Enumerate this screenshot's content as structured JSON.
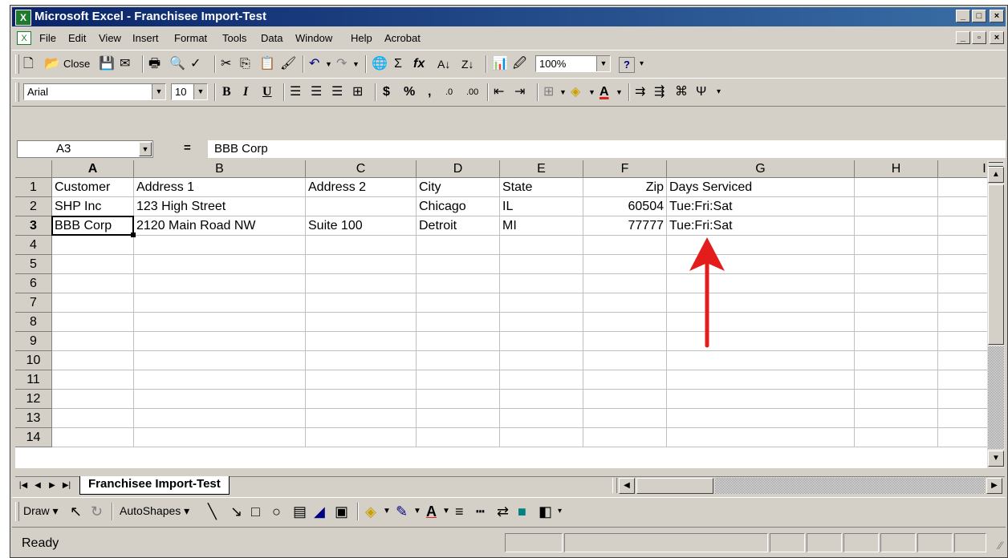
{
  "window": {
    "title": "Microsoft Excel - Franchisee Import-Test",
    "app_icon": "excel-icon"
  },
  "caption_buttons": {
    "minimize": "_",
    "restore": "□",
    "close": "×"
  },
  "menu": {
    "items": [
      "File",
      "Edit",
      "View",
      "Insert",
      "Format",
      "Tools",
      "Data",
      "Window",
      "Help",
      "Acrobat"
    ],
    "doc_buttons": {
      "minimize": "_",
      "restore": "▫",
      "close": "×"
    }
  },
  "standard_toolbar": {
    "close_label": "Close",
    "undo_glyph": "↶",
    "redo_glyph": "↷",
    "sum_glyph": "Σ",
    "function_glyph": "fx",
    "zoom": "100%",
    "help_glyph": "?"
  },
  "format_toolbar": {
    "font": "Arial",
    "size": "10",
    "bold": "B",
    "italic": "I",
    "underline": "U",
    "currency": "$",
    "percent": "%",
    "comma": ",",
    "increase_decimal": ".0",
    "decrease_decimal": ".00",
    "font_color_glyph": "A"
  },
  "formula_bar": {
    "name_box": "A3",
    "equals": "=",
    "value": "BBB Corp"
  },
  "sheet": {
    "columns": [
      "A",
      "B",
      "C",
      "D",
      "E",
      "F",
      "G",
      "H",
      "I"
    ],
    "rows": [
      "1",
      "2",
      "3",
      "4",
      "5",
      "6",
      "7",
      "8",
      "9",
      "10",
      "11",
      "12",
      "13",
      "14"
    ],
    "active_cell": "A3",
    "data": [
      [
        "Customer",
        "Address 1",
        "Address 2",
        "City",
        "State",
        "Zip",
        "Days Serviced"
      ],
      [
        "SHP Inc",
        "123 High Street",
        "",
        "Chicago",
        "IL",
        "60504",
        "Tue:Fri:Sat"
      ],
      [
        "BBB Corp",
        "2120 Main Road NW",
        "Suite 100",
        "Detroit",
        "MI",
        "77777",
        "Tue:Fri:Sat"
      ]
    ],
    "annotation": {
      "type": "red-arrow",
      "color": "#e31c1c",
      "points_to": "G3"
    }
  },
  "sheet_tabs": {
    "active": "Franchisee Import-Test",
    "nav_glyphs": [
      "|◀",
      "◀",
      "▶",
      "▶|"
    ]
  },
  "drawing_toolbar": {
    "draw_label": "Draw",
    "autoshapes_label": "AutoShapes"
  },
  "status_bar": {
    "text": "Ready"
  }
}
